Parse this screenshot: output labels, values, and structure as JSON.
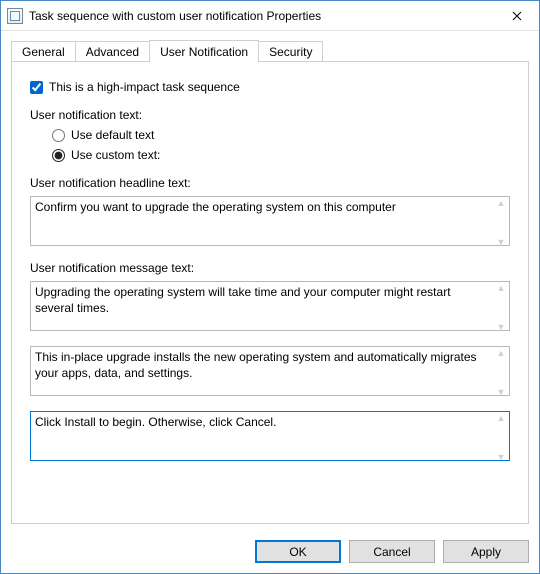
{
  "window": {
    "title": "Task sequence with custom user notification Properties"
  },
  "tabs": {
    "general": "General",
    "advanced": "Advanced",
    "user_notification": "User Notification",
    "security": "Security"
  },
  "panel": {
    "high_impact_label": "This is a high-impact task sequence",
    "high_impact_checked": "true",
    "notif_text_label": "User notification text:",
    "radio_default": "Use default text",
    "radio_custom": "Use custom text:",
    "radio_selected": "custom",
    "headline_label": "User notification headline text:",
    "headline_value": "Confirm you want to upgrade the operating system on this computer",
    "message_label": "User notification message text:",
    "message1_value": "Upgrading the operating system will take time and your computer might restart several times.",
    "message2_value": "This in-place upgrade installs the new operating system and automatically migrates your apps, data, and settings.",
    "message3_value": "Click Install to begin. Otherwise, click Cancel."
  },
  "buttons": {
    "ok": "OK",
    "cancel": "Cancel",
    "apply": "Apply"
  }
}
